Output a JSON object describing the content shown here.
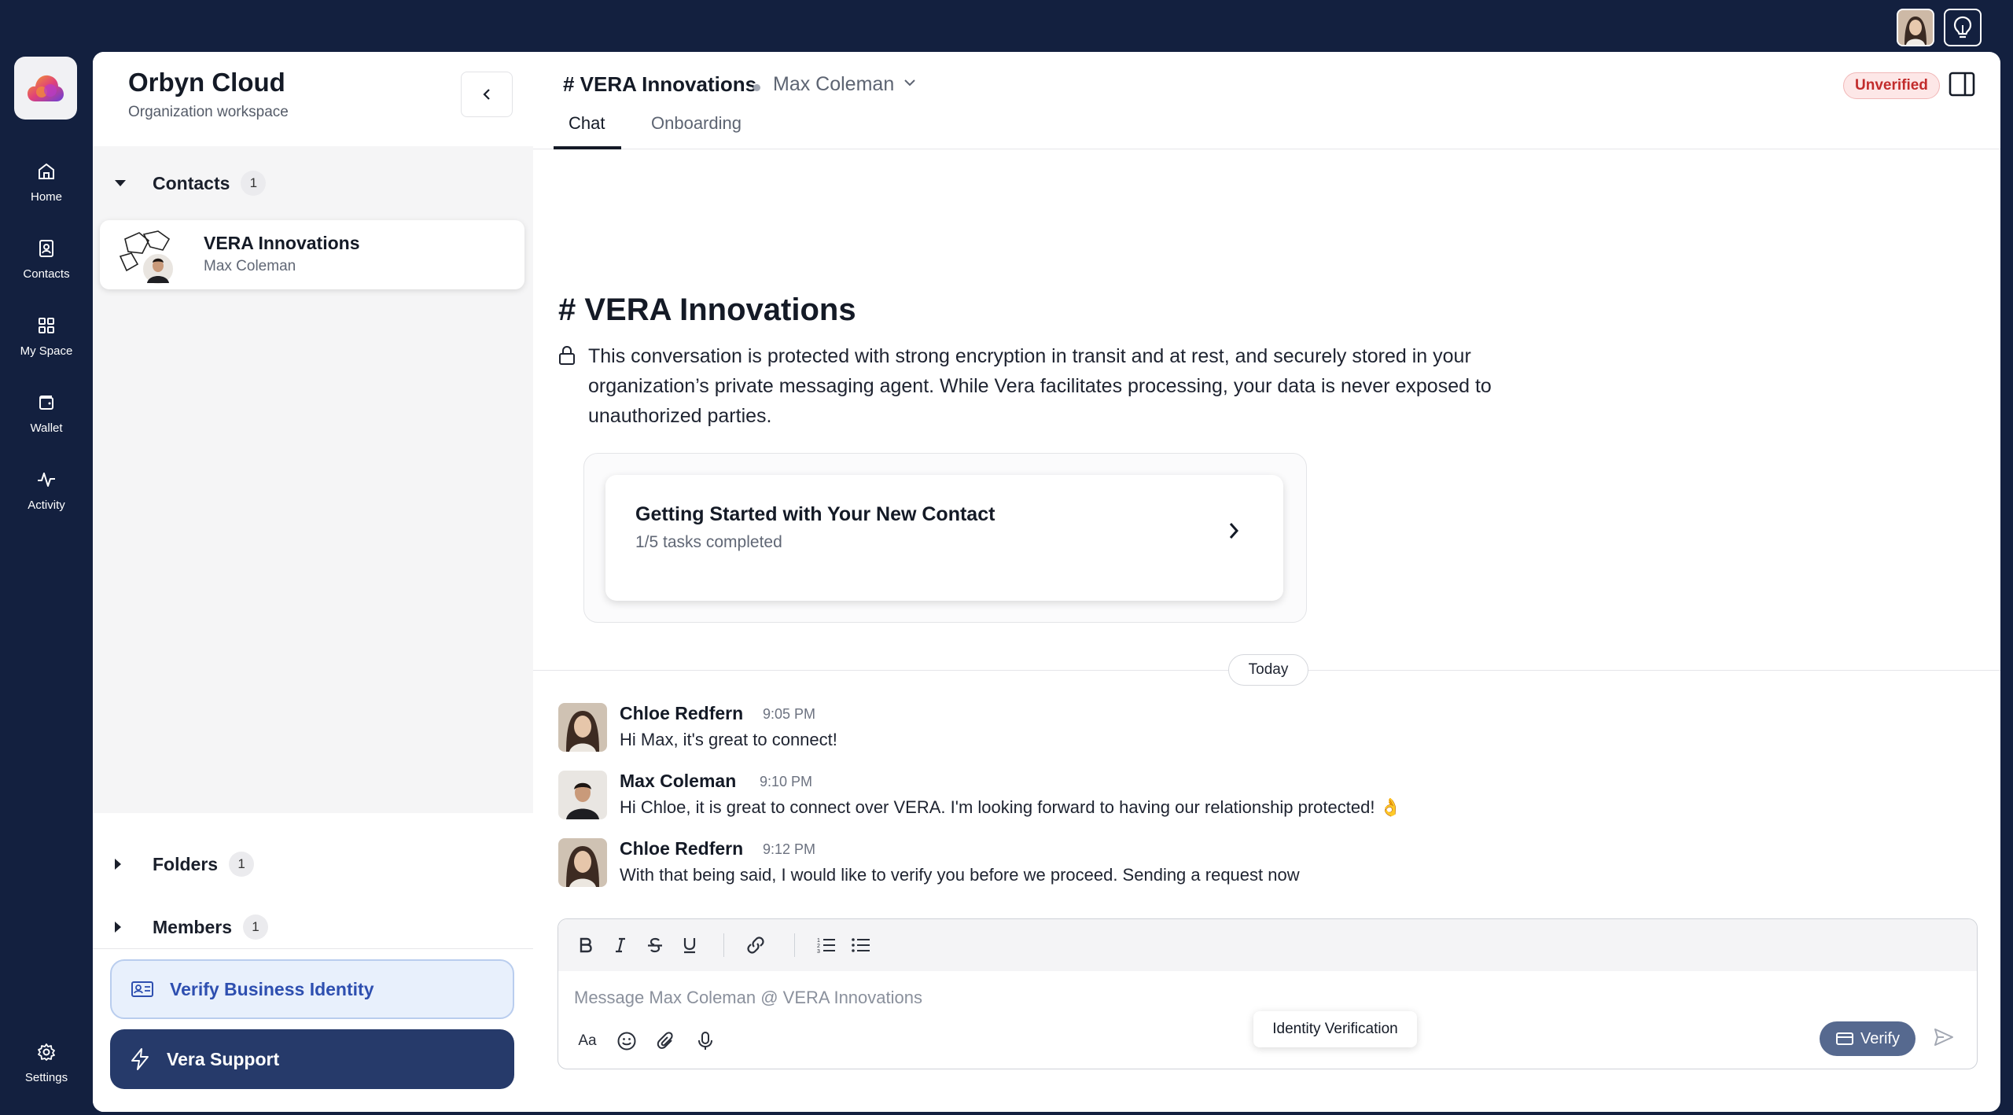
{
  "rail": {
    "items": [
      {
        "label": "Home",
        "icon": "home-icon"
      },
      {
        "label": "Contacts",
        "icon": "contacts-icon"
      },
      {
        "label": "My Space",
        "icon": "grid-icon"
      },
      {
        "label": "Wallet",
        "icon": "wallet-icon"
      },
      {
        "label": "Activity",
        "icon": "activity-icon"
      }
    ],
    "settings_label": "Settings"
  },
  "sidebar": {
    "title": "Orbyn Cloud",
    "subtitle": "Organization workspace",
    "sections": {
      "contacts": {
        "label": "Contacts",
        "count": "1"
      },
      "folders": {
        "label": "Folders",
        "count": "1"
      },
      "members": {
        "label": "Members",
        "count": "1"
      }
    },
    "contact": {
      "name": "VERA Innovations",
      "person": "Max Coleman"
    },
    "verify_business_label": "Verify Business Identity",
    "vera_support_label": "Vera Support"
  },
  "header": {
    "channel": "# VERA Innovations",
    "person": "Max Coleman",
    "tabs": [
      "Chat",
      "Onboarding"
    ],
    "status_badge": "Unverified"
  },
  "intro": {
    "title": "# VERA Innovations",
    "encryption_notice": "This conversation is protected with strong encryption in transit and at rest, and securely stored in your organization’s private messaging agent. While Vera facilitates processing, your data is never exposed to unauthorized parties."
  },
  "getting_started": {
    "title": "Getting Started with Your New Contact",
    "progress": "1/5 tasks completed"
  },
  "date_divider": "Today",
  "messages": [
    {
      "author": "Chloe Redfern",
      "time": "9:05 PM",
      "text": "Hi Max, it's great to connect!"
    },
    {
      "author": "Max Coleman",
      "time": "9:10 PM",
      "text": "Hi Chloe, it is great to connect over VERA. I'm looking forward to having our relationship protected! 👌"
    },
    {
      "author": "Chloe Redfern",
      "time": "9:12 PM",
      "text": "With that being said, I would like to verify you before we proceed. Sending a request now"
    }
  ],
  "composer": {
    "placeholder": "Message Max Coleman @ VERA Innovations",
    "format_label": "Aa",
    "verify_label": "Verify",
    "tooltip": "Identity Verification"
  },
  "colors": {
    "background": "#13203f",
    "accent": "#263a6a",
    "unverified": "#c22c2c",
    "verify_button": "#56698f"
  }
}
